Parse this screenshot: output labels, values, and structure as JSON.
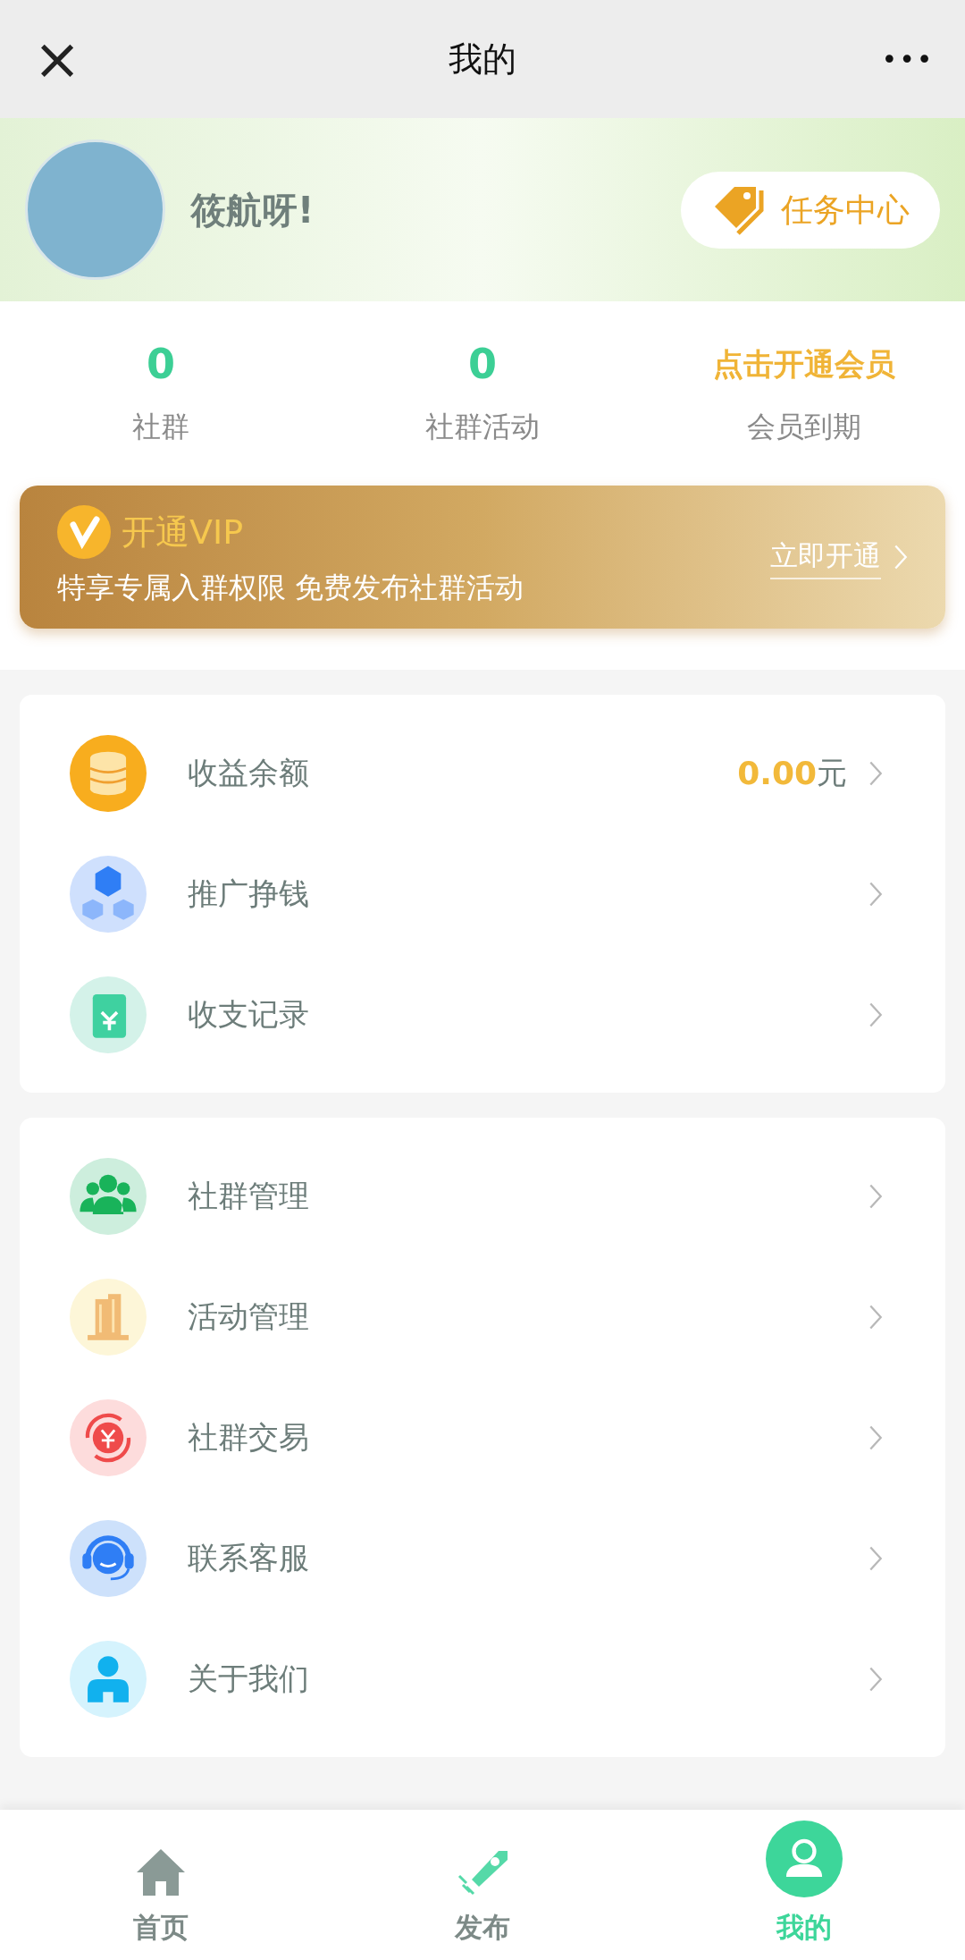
{
  "title_bar": {
    "close": "×",
    "title": "我的",
    "more": "•••"
  },
  "profile": {
    "name": "筱航呀!",
    "task_button": "任务中心"
  },
  "stats": [
    {
      "value": "0",
      "label": "社群",
      "kind": "count"
    },
    {
      "value": "0",
      "label": "社群活动",
      "kind": "count"
    },
    {
      "value": "点击开通会员",
      "label": "会员到期",
      "kind": "link"
    }
  ],
  "vip_banner": {
    "title": "开通VIP",
    "subtitle": "特享专属入群权限 免费发布社群活动",
    "action": "立即开通"
  },
  "menu_groups": [
    {
      "items": [
        {
          "label": "收益余额",
          "amount": "0.00",
          "unit": "元"
        },
        {
          "label": "推广挣钱"
        },
        {
          "label": "收支记录"
        }
      ]
    },
    {
      "items": [
        {
          "label": "社群管理"
        },
        {
          "label": "活动管理"
        },
        {
          "label": "社群交易"
        },
        {
          "label": "联系客服"
        },
        {
          "label": "关于我们"
        }
      ]
    }
  ],
  "tab_bar": [
    {
      "label": "首页",
      "selected": false
    },
    {
      "label": "发布",
      "selected": false
    },
    {
      "label": "我的",
      "selected": true
    }
  ]
}
